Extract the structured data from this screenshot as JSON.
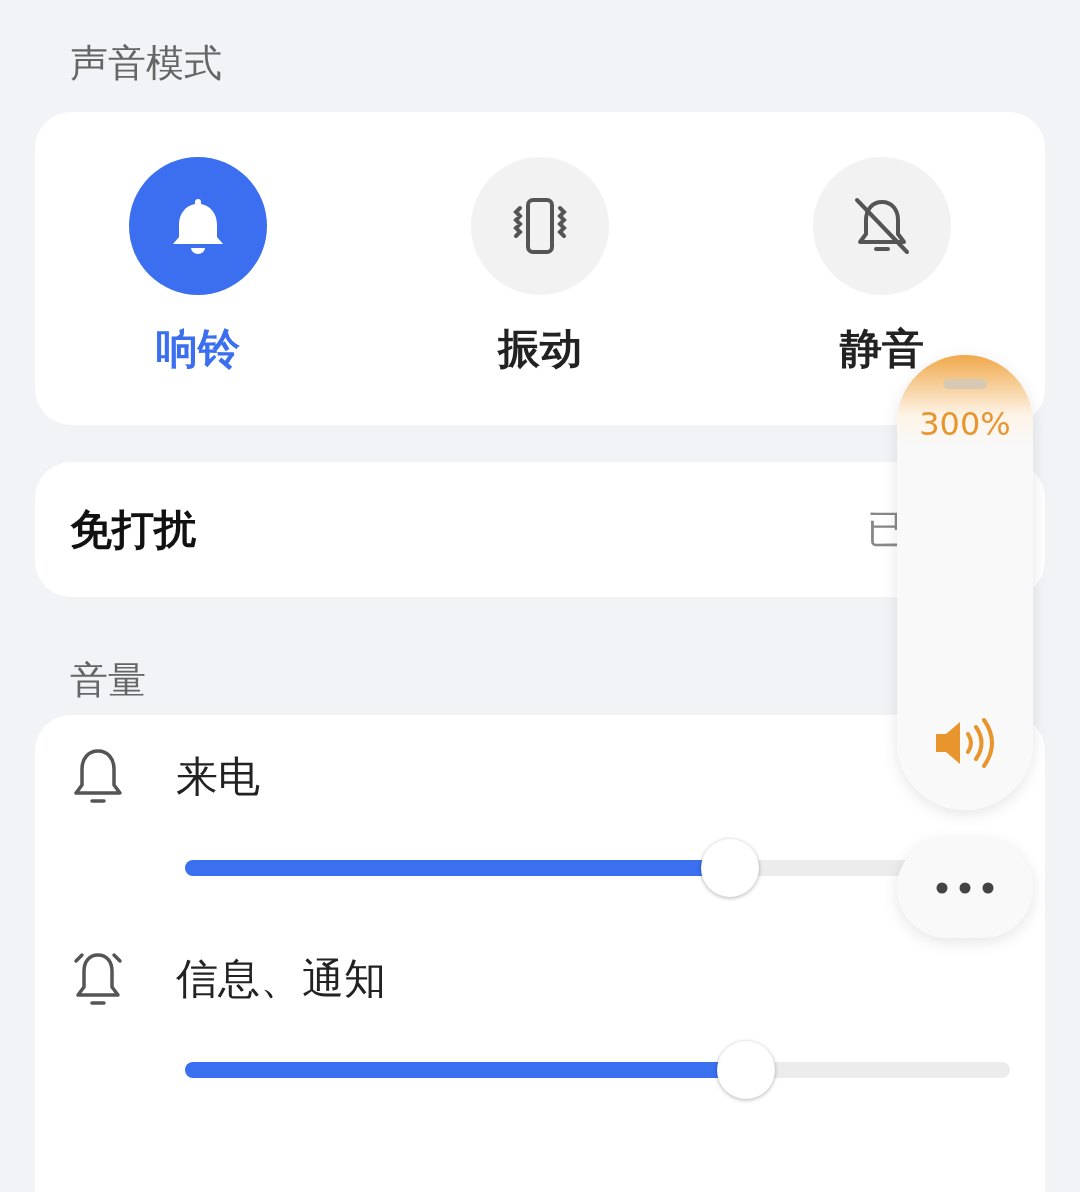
{
  "sound_mode": {
    "heading": "声音模式",
    "modes": [
      {
        "kind": "ring",
        "label": "响铃",
        "selected": true
      },
      {
        "kind": "vibrate",
        "label": "振动",
        "selected": false
      },
      {
        "kind": "silent",
        "label": "静音",
        "selected": false
      }
    ]
  },
  "do_not_disturb": {
    "label": "免打扰",
    "value": "已"
  },
  "volume": {
    "heading": "音量",
    "rows": [
      {
        "kind": "call",
        "label": "来电",
        "level": 0.66
      },
      {
        "kind": "notify",
        "label": "信息、通知",
        "level": 0.68
      }
    ]
  },
  "volume_popup": {
    "reading": "300%"
  }
}
